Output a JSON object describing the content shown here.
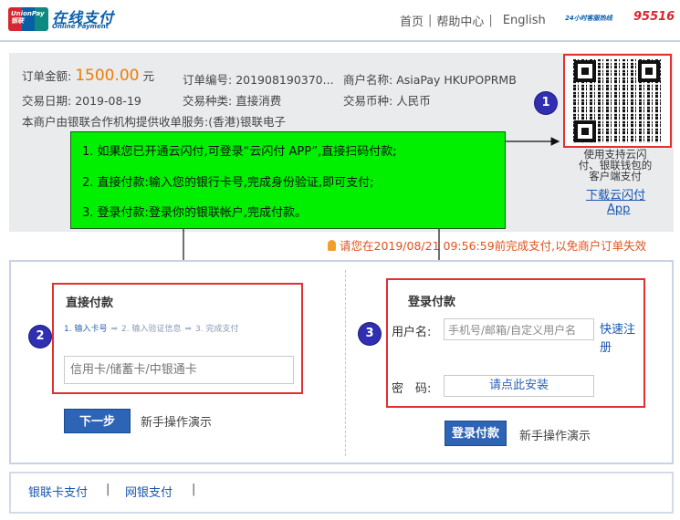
{
  "header": {
    "logo_text": "UnionPay 银联",
    "brand_cn": "在线支付",
    "brand_en": "Online Payment",
    "nav": {
      "home": "首页",
      "sep1": "|",
      "help": "帮助中心",
      "sep2": "|",
      "english": "English"
    },
    "hotline_label": "24小时客服热线",
    "hotline_number": "95516"
  },
  "order": {
    "amount_label": "订单金额:",
    "amount_value": "1500.00",
    "amount_unit": "元",
    "order_no_label": "订单编号:",
    "order_no_value": "201908190370...",
    "merchant_label": "商户名称:",
    "merchant_value": "AsiaPay HKUPOPRMB",
    "date_label": "交易日期:",
    "date_value": "2019-08-19",
    "type_label": "交易种类:",
    "type_value": "直接消费",
    "currency_label": "交易币种:",
    "currency_value": "人民币",
    "service_note": "本商户由银联合作机构提供收单服务:(香港)银联电子"
  },
  "qr": {
    "caption": "使用支持云闪付、银联钱包的客户端支付",
    "download_link_line1": "下载云闪付",
    "download_link_line2": "App"
  },
  "instructions": [
    "1. 如果您已开通云闪付,可登录“云闪付 APP”,直接扫码付款;",
    "2. 直接付款:输入您的银行卡号,完成身份验证,即可支付;",
    "3. 登录付款:登录你的银联帐户,完成付款。"
  ],
  "badges": [
    "1",
    "2",
    "3"
  ],
  "notice": "请您在2019/08/21 09:56:59前完成支付,以免商户订单失效",
  "direct_pay": {
    "title": "直接付款",
    "steps": [
      "1. 输入卡号",
      "2. 输入验证信息",
      "3. 完成支付"
    ],
    "card_placeholder": "信用卡/储蓄卡/中银通卡",
    "next_button": "下一步",
    "demo_link": "新手操作演示"
  },
  "login_pay": {
    "title": "登录付款",
    "username_label": "用户名:",
    "username_placeholder": "手机号/邮箱/自定义用户名",
    "register_link": "快速注册",
    "password_label": "密　码:",
    "password_field": "请点此安装",
    "login_button": "登录付款",
    "demo_link": "新手操作演示"
  },
  "bottom": {
    "card_pay": "银联卡支付",
    "sep1": "|",
    "bank_pay": "网银支付",
    "sep2": "|"
  },
  "colors": {
    "brand_blue": "#0a5ea8",
    "amount_orange": "#f07c00",
    "annotation_red": "#e03030",
    "annotation_green": "#00f000",
    "button_blue": "#2d64b5",
    "badge_navy": "#2f2fb0"
  }
}
